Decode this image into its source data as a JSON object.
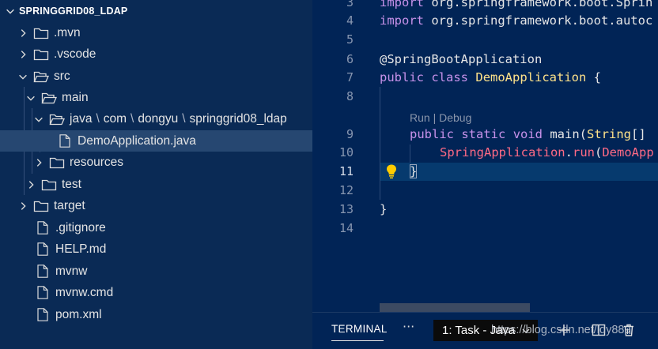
{
  "explorer": {
    "title": "SPRINGGRID08_LDAP",
    "items": [
      {
        "label": ".mvn",
        "type": "folder"
      },
      {
        "label": ".vscode",
        "type": "folder"
      },
      {
        "label": "src",
        "type": "folder"
      },
      {
        "label": "main",
        "type": "folder"
      },
      {
        "path": [
          "java",
          "com",
          "dongyu",
          "springgrid08_ldap"
        ],
        "separator": "\\",
        "type": "folder"
      },
      {
        "label": "DemoApplication.java",
        "type": "file"
      },
      {
        "label": "resources",
        "type": "folder"
      },
      {
        "label": "test",
        "type": "folder"
      },
      {
        "label": "target",
        "type": "folder"
      },
      {
        "label": ".gitignore",
        "type": "file"
      },
      {
        "label": "HELP.md",
        "type": "file"
      },
      {
        "label": "mvnw",
        "type": "file"
      },
      {
        "label": "mvnw.cmd",
        "type": "file"
      },
      {
        "label": "pom.xml",
        "type": "file"
      }
    ]
  },
  "editor": {
    "line_numbers": [
      "3",
      "4",
      "5",
      "6",
      "7",
      "8",
      "9",
      "10",
      "11",
      "12",
      "13",
      "14"
    ],
    "active_line": "11",
    "codelens": "Run | Debug",
    "code": {
      "l3": [
        "import",
        " org.springframework.boot.Sprin"
      ],
      "l4": [
        "import",
        " org.springframework.boot.autoc"
      ],
      "l6": "@SpringBootApplication",
      "l7": [
        "public",
        " ",
        "class",
        " ",
        "DemoApplication",
        " {"
      ],
      "l9": [
        "public",
        " ",
        "static",
        " ",
        "void",
        " main(",
        "String",
        "[] "
      ],
      "l10": [
        "SpringApplication",
        ".",
        "run",
        "(",
        "DemoApp"
      ],
      "l11": "}",
      "l13": "}"
    }
  },
  "panel": {
    "tab_label": "TERMINAL",
    "more_label": "···",
    "task_select": "1: Task - Java",
    "watermark": "https://blog.csdn.net/ldy889"
  },
  "colors": {
    "background": "#012456",
    "explorer_bg": "#0a2a55",
    "selection": "#264771",
    "keyword": "#c792ea",
    "class": "#ffe38a",
    "red_token": "#ff6a85"
  }
}
